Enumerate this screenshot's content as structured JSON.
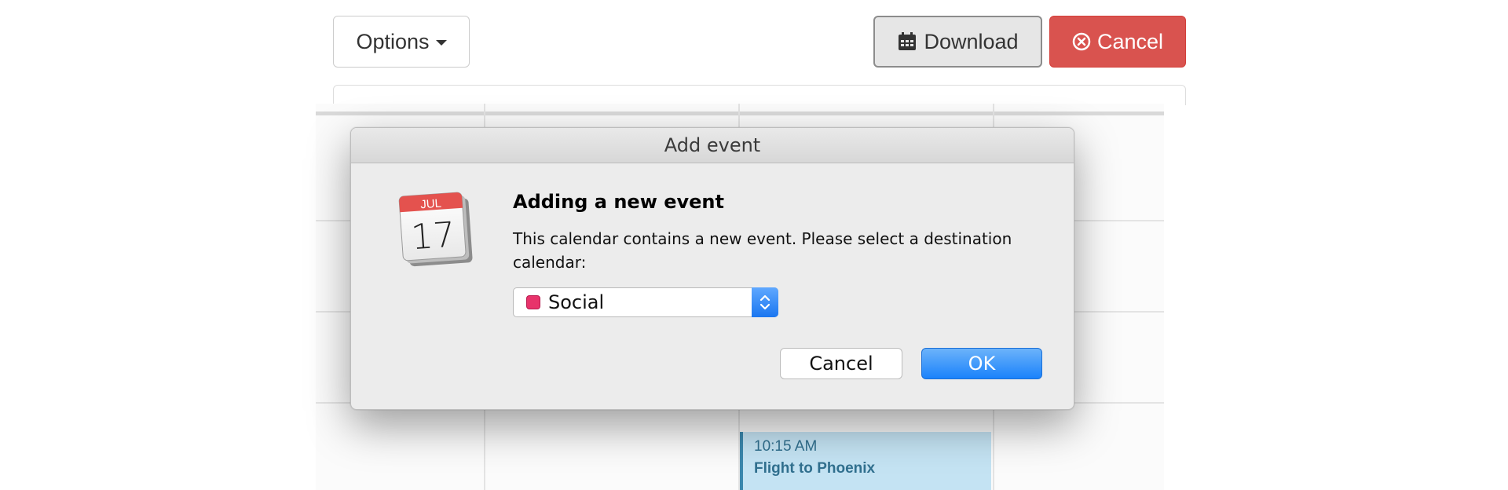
{
  "toolbar": {
    "options_label": "Options",
    "download_label": "Download",
    "cancel_label": "Cancel"
  },
  "calendar_event": {
    "time": "10:15 AM",
    "title": "Flight to Phoenix"
  },
  "dialog": {
    "title": "Add event",
    "app_icon": {
      "month": "JUL",
      "day": "17"
    },
    "heading": "Adding a new event",
    "message": "This calendar contains a new event. Please select a destination calendar:",
    "calendar_select": {
      "selected": "Social",
      "color": "#e8336b"
    },
    "cancel_label": "Cancel",
    "ok_label": "OK"
  },
  "colors": {
    "danger": "#d9534f",
    "accent_blue": "#1a82fb",
    "event_bg": "#c4e3f3",
    "event_border": "#3a87ad",
    "calendar_icon_red": "#e4524e"
  },
  "icons": [
    "caret-down-icon",
    "calendar-icon",
    "circle-x-icon",
    "calendar-app-icon",
    "select-stepper-icon"
  ]
}
